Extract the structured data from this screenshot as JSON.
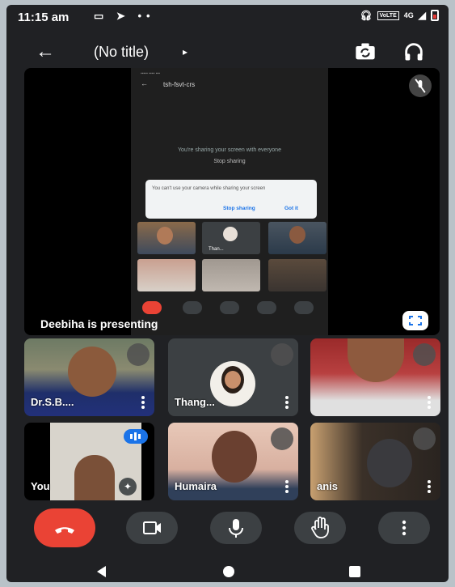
{
  "status_bar": {
    "time": "11:15 am",
    "icons": [
      "chat-head-icon",
      "send-icon",
      "more-dots-icon"
    ],
    "right_icons": [
      "headset-icon",
      "volte-icon",
      "signal-4g-icon",
      "signal-icon",
      "battery-low-icon"
    ],
    "volte_text": "VoLTE",
    "network": "4G"
  },
  "top_bar": {
    "title": "(No title)",
    "caret": "▸"
  },
  "presentation": {
    "label": "Deebiha is presenting",
    "mirrored": {
      "meeting_code": "tsh-fsvt-crs",
      "sharing_message": "You're sharing your screen with everyone",
      "stop_sharing_label": "Stop sharing",
      "dialog_text": "You can't use your camera while sharing your screen",
      "dialog_stop_label": "Stop sharing",
      "dialog_ok_label": "Got it",
      "thumb_name": "Than..."
    }
  },
  "participants": [
    {
      "name": "Dr.S.B....",
      "muted": true
    },
    {
      "name": "Thang...",
      "muted": true
    },
    {
      "name": "",
      "muted": true
    },
    {
      "name": "You",
      "speaking": true
    },
    {
      "name": "Humaira",
      "muted": true
    },
    {
      "name": "anis",
      "muted": true
    }
  ],
  "colors": {
    "background": "#202124",
    "end_call": "#ea4335",
    "control_button": "#3c4043",
    "accent_blue": "#1a73e8"
  }
}
